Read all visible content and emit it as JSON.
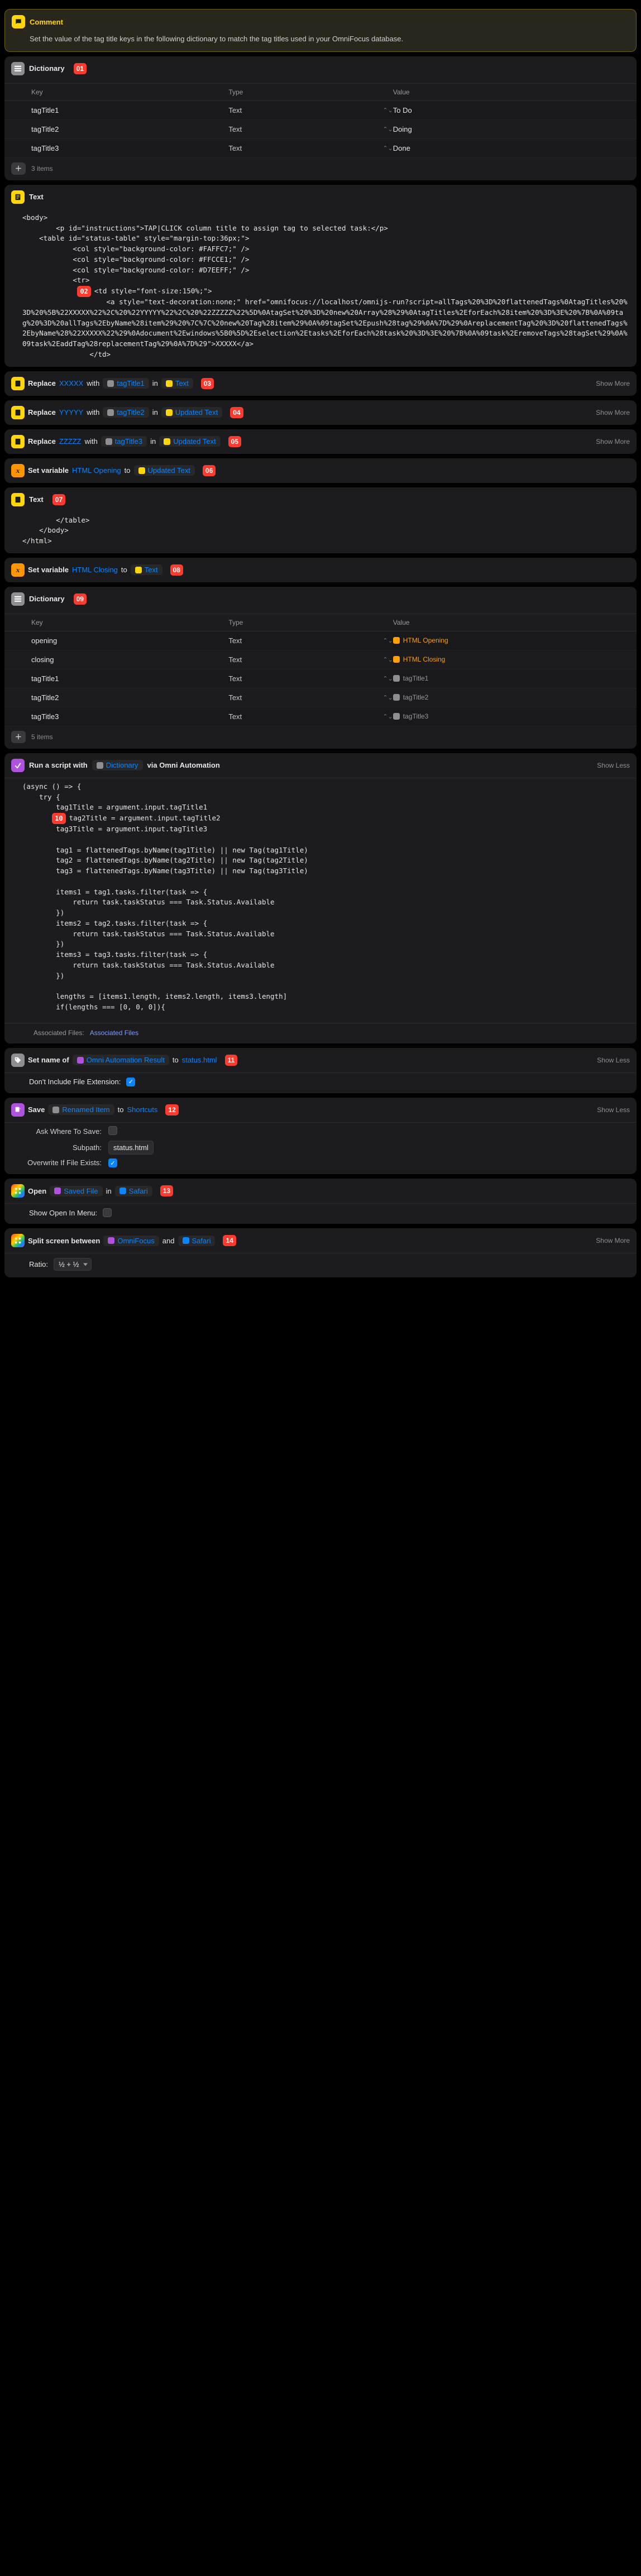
{
  "comment": {
    "title": "Comment",
    "body": "Set the value of the tag title keys in the following dictionary to match the tag titles used in your OmniFocus database."
  },
  "dict1": {
    "title": "Dictionary",
    "badge": "01",
    "cols": {
      "key": "Key",
      "type": "Type",
      "value": "Value"
    },
    "rows": [
      {
        "key": "tagTitle1",
        "type": "Text",
        "value": "To Do"
      },
      {
        "key": "tagTitle2",
        "type": "Text",
        "value": "Doing"
      },
      {
        "key": "tagTitle3",
        "type": "Text",
        "value": "Done"
      }
    ],
    "count": "3 items"
  },
  "text1": {
    "title": "Text",
    "badge": "02",
    "pre": "<body>\n        <p id=\"instructions\">TAP|CLICK column title to assign tag to selected task:</p>\n    <table id=\"status-table\" style=\"margin-top:36px;\">\n            <col style=\"background-color: #FAFFC7;\" />\n            <col style=\"background-color: #FFCCE1;\" />\n            <col style=\"background-color: #D7EEFF;\" />\n            <tr>",
    "mid": "<td style=\"font-size:150%;\">\n                    <a style=\"text-decoration:none;\" href=\"omnifocus://localhost/omnijs-run?script=allTags%20%3D%20flattenedTags%0AtagTitles%20%3D%20%5B%22XXXXX%22%2C%20%22YYYYY%22%2C%20%22ZZZZZ%22%5D%0AtagSet%20%3D%20new%20Array%28%29%0AtagTitles%2EforEach%28item%20%3D%3E%20%7B%0A%09tag%20%3D%20allTags%2EbyName%28item%29%20%7C%7C%20new%20Tag%28item%29%0A%09tagSet%2Epush%28tag%29%0A%7D%29%0AreplacementTag%20%3D%20flattenedTags%2EbyName%28%22XXXXX%22%29%0Adocument%2Ewindows%5B0%5D%2Eselection%2Etasks%2EforEach%28task%20%3D%3E%20%7B%0A%09task%2EremoveTags%28tagSet%29%0A%09task%2EaddTag%28replacementTag%29%0A%7D%29\">XXXXX</a>\n                </td>"
  },
  "replace": {
    "word_replace": "Replace",
    "word_with": "with",
    "word_in": "in",
    "showmore": "Show More",
    "items": [
      {
        "find": "XXXXX",
        "repl": "tagTitle1",
        "src": "Text",
        "badge": "03",
        "srcColor": "y"
      },
      {
        "find": "YYYYY",
        "repl": "tagTitle2",
        "src": "Updated Text",
        "badge": "04",
        "srcColor": "y"
      },
      {
        "find": "ZZZZZ",
        "repl": "tagTitle3",
        "src": "Updated Text",
        "badge": "05",
        "srcColor": "y"
      }
    ]
  },
  "setvar1": {
    "title": "Set variable",
    "var": "HTML Opening",
    "to": "to",
    "src": "Updated Text",
    "badge": "06"
  },
  "text2": {
    "title": "Text",
    "badge": "07",
    "body": "        </table>\n    </body>\n</html>"
  },
  "setvar2": {
    "title": "Set variable",
    "var": "HTML Closing",
    "to": "to",
    "src": "Text",
    "badge": "08"
  },
  "dict2": {
    "title": "Dictionary",
    "badge": "09",
    "cols": {
      "key": "Key",
      "type": "Type",
      "value": "Value"
    },
    "rows": [
      {
        "key": "opening",
        "type": "Text",
        "vlabel": "HTML Opening",
        "vcolor": "orange"
      },
      {
        "key": "closing",
        "type": "Text",
        "vlabel": "HTML Closing",
        "vcolor": "orange"
      },
      {
        "key": "tagTitle1",
        "type": "Text",
        "vlabel": "tagTitle1",
        "vcolor": "gray"
      },
      {
        "key": "tagTitle2",
        "type": "Text",
        "vlabel": "tagTitle2",
        "vcolor": "gray"
      },
      {
        "key": "tagTitle3",
        "type": "Text",
        "vlabel": "tagTitle3",
        "vcolor": "gray"
      }
    ],
    "count": "5 items"
  },
  "script": {
    "prefix": "Run a script with",
    "input": "Dictionary",
    "suffix": "via Omni Automation",
    "showless": "Show Less",
    "badge": "10",
    "code_pre": "(async () => {\n    try {\n        tag1Title = argument.input.tagTitle1",
    "code_post": "tag2Title = argument.input.tagTitle2\n        tag3Title = argument.input.tagTitle3\n\n        tag1 = flattenedTags.byName(tag1Title) || new Tag(tag1Title)\n        tag2 = flattenedTags.byName(tag2Title) || new Tag(tag2Title)\n        tag3 = flattenedTags.byName(tag3Title) || new Tag(tag3Title)\n\n        items1 = tag1.tasks.filter(task => {\n            return task.taskStatus === Task.Status.Available\n        })\n        items2 = tag2.tasks.filter(task => {\n            return task.taskStatus === Task.Status.Available\n        })\n        items3 = tag3.tasks.filter(task => {\n            return task.taskStatus === Task.Status.Available\n        })\n\n        lengths = [items1.length, items2.length, items3.length]\n        if(lengths === [0, 0, 0]){",
    "assoc_label": "Associated Files:",
    "assoc_value": "Associated Files"
  },
  "setname": {
    "prefix": "Set name of",
    "input": "Omni Automation Result",
    "to": "to",
    "value": "status.html",
    "badge": "11",
    "showless": "Show Less",
    "extlabel": "Don't Include File Extension:"
  },
  "save": {
    "prefix": "Save",
    "input": "Renamed Item",
    "to": "to",
    "dest": "Shortcuts",
    "badge": "12",
    "showless": "Show Less",
    "asklabel": "Ask Where To Save:",
    "subpathlabel": "Subpath:",
    "subpathvalue": "status.html",
    "overwritelabel": "Overwrite If File Exists:"
  },
  "open": {
    "prefix": "Open",
    "input": "Saved File",
    "in": "in",
    "app": "Safari",
    "badge": "13",
    "menulabel": "Show Open In Menu:"
  },
  "split": {
    "prefix": "Split screen between",
    "app1": "OmniFocus",
    "and": "and",
    "app2": "Safari",
    "badge": "14",
    "showmore": "Show More",
    "ratiolabel": "Ratio:",
    "ratiovalue": "½ + ½"
  }
}
